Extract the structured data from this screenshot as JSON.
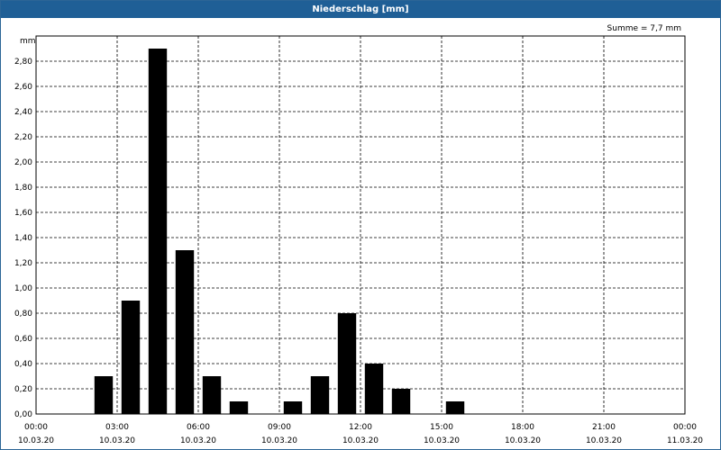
{
  "window": {
    "title": "Niederschlag [mm]"
  },
  "chart_data": {
    "type": "bar",
    "title": "Niederschlag [mm]",
    "ylabel": "mm",
    "summary": "Summe = 7,7 mm",
    "ylim": [
      0,
      3.0
    ],
    "x_range_hours": [
      0,
      24
    ],
    "bar_interval_hours": 1,
    "y_ticks": [
      0,
      0.2,
      0.4,
      0.6,
      0.8,
      1.0,
      1.2,
      1.4,
      1.6,
      1.8,
      2.0,
      2.2,
      2.4,
      2.6,
      2.8
    ],
    "y_tick_labels": [
      "0,00",
      "0,20",
      "0,40",
      "0,60",
      "0,80",
      "1,00",
      "1,20",
      "1,40",
      "1,60",
      "1,80",
      "2,00",
      "2,20",
      "2,40",
      "2,60",
      "2,80"
    ],
    "x_ticks": [
      {
        "hour": 0,
        "time": "00:00",
        "date": "10.03.20"
      },
      {
        "hour": 3,
        "time": "03:00",
        "date": "10.03.20"
      },
      {
        "hour": 6,
        "time": "06:00",
        "date": "10.03.20"
      },
      {
        "hour": 9,
        "time": "09:00",
        "date": "10.03.20"
      },
      {
        "hour": 12,
        "time": "12:00",
        "date": "10.03.20"
      },
      {
        "hour": 15,
        "time": "15:00",
        "date": "10.03.20"
      },
      {
        "hour": 18,
        "time": "18:00",
        "date": "10.03.20"
      },
      {
        "hour": 21,
        "time": "21:00",
        "date": "10.03.20"
      },
      {
        "hour": 24,
        "time": "00:00",
        "date": "11.03.20"
      }
    ],
    "bars": [
      {
        "hour": 3,
        "value": 0.3
      },
      {
        "hour": 4,
        "value": 0.9
      },
      {
        "hour": 5,
        "value": 2.9
      },
      {
        "hour": 6,
        "value": 1.3
      },
      {
        "hour": 7,
        "value": 0.3
      },
      {
        "hour": 8,
        "value": 0.1
      },
      {
        "hour": 10,
        "value": 0.1
      },
      {
        "hour": 11,
        "value": 0.3
      },
      {
        "hour": 12,
        "value": 0.8
      },
      {
        "hour": 13,
        "value": 0.4
      },
      {
        "hour": 14,
        "value": 0.2
      },
      {
        "hour": 16,
        "value": 0.1
      }
    ],
    "grid": true,
    "colors": {
      "bar": "#000000",
      "title_bar": "#1f5f96"
    }
  }
}
